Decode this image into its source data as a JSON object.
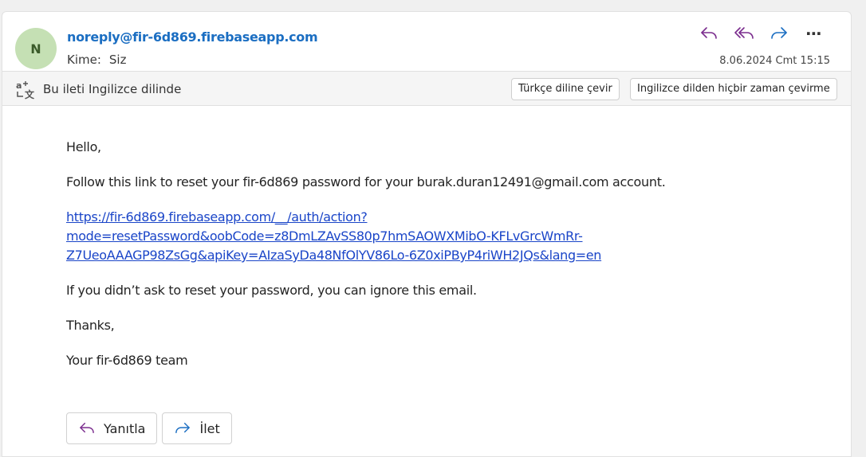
{
  "message": {
    "avatar_initial": "N",
    "sender": "noreply@fir-6d869.firebaseapp.com",
    "to_label": "Kime:",
    "to_value": "Siz",
    "date": "8.06.2024 Cmt 15:15"
  },
  "actions": {
    "icons": [
      "reply-icon",
      "reply-all-icon",
      "forward-icon",
      "more-icon"
    ],
    "more_label": "⋯"
  },
  "translation": {
    "notice": "Bu ileti Ingilizce dilinde",
    "translate_button": "Türkçe diline çevir",
    "never_button": "Ingilizce dilden hiçbir zaman çevirme"
  },
  "body": {
    "greeting": "Hello,",
    "instruction": "Follow this link to reset your fir-6d869 password for your burak.duran12491@gmail.com account.",
    "link_line1": "https://fir-6d869.firebaseapp.com/__/auth/action?",
    "link_line2": "mode=resetPassword&oobCode=z8DmLZAvSS80p7hmSAOWXMibO-KFLvGrcWmRr-",
    "link_line3": "Z7UeoAAAGP98ZsGg&apiKey=AIzaSyDa48NfOlYV86Lo-6Z0xiPByP4riWH2JQs&lang=en",
    "ignore_note": "If you didn’t ask to reset your password, you can ignore this email.",
    "thanks": "Thanks,",
    "signature": "Your fir-6d869 team"
  },
  "reply_bar": {
    "reply_label": "Yanıtla",
    "forward_label": "İlet"
  },
  "colors": {
    "sender": "#1b6ec2",
    "link": "#1a45c8",
    "reply_icon": "#7b2d8e",
    "forward_icon": "#1b6ec2",
    "avatar_bg": "#c5e0b4"
  }
}
